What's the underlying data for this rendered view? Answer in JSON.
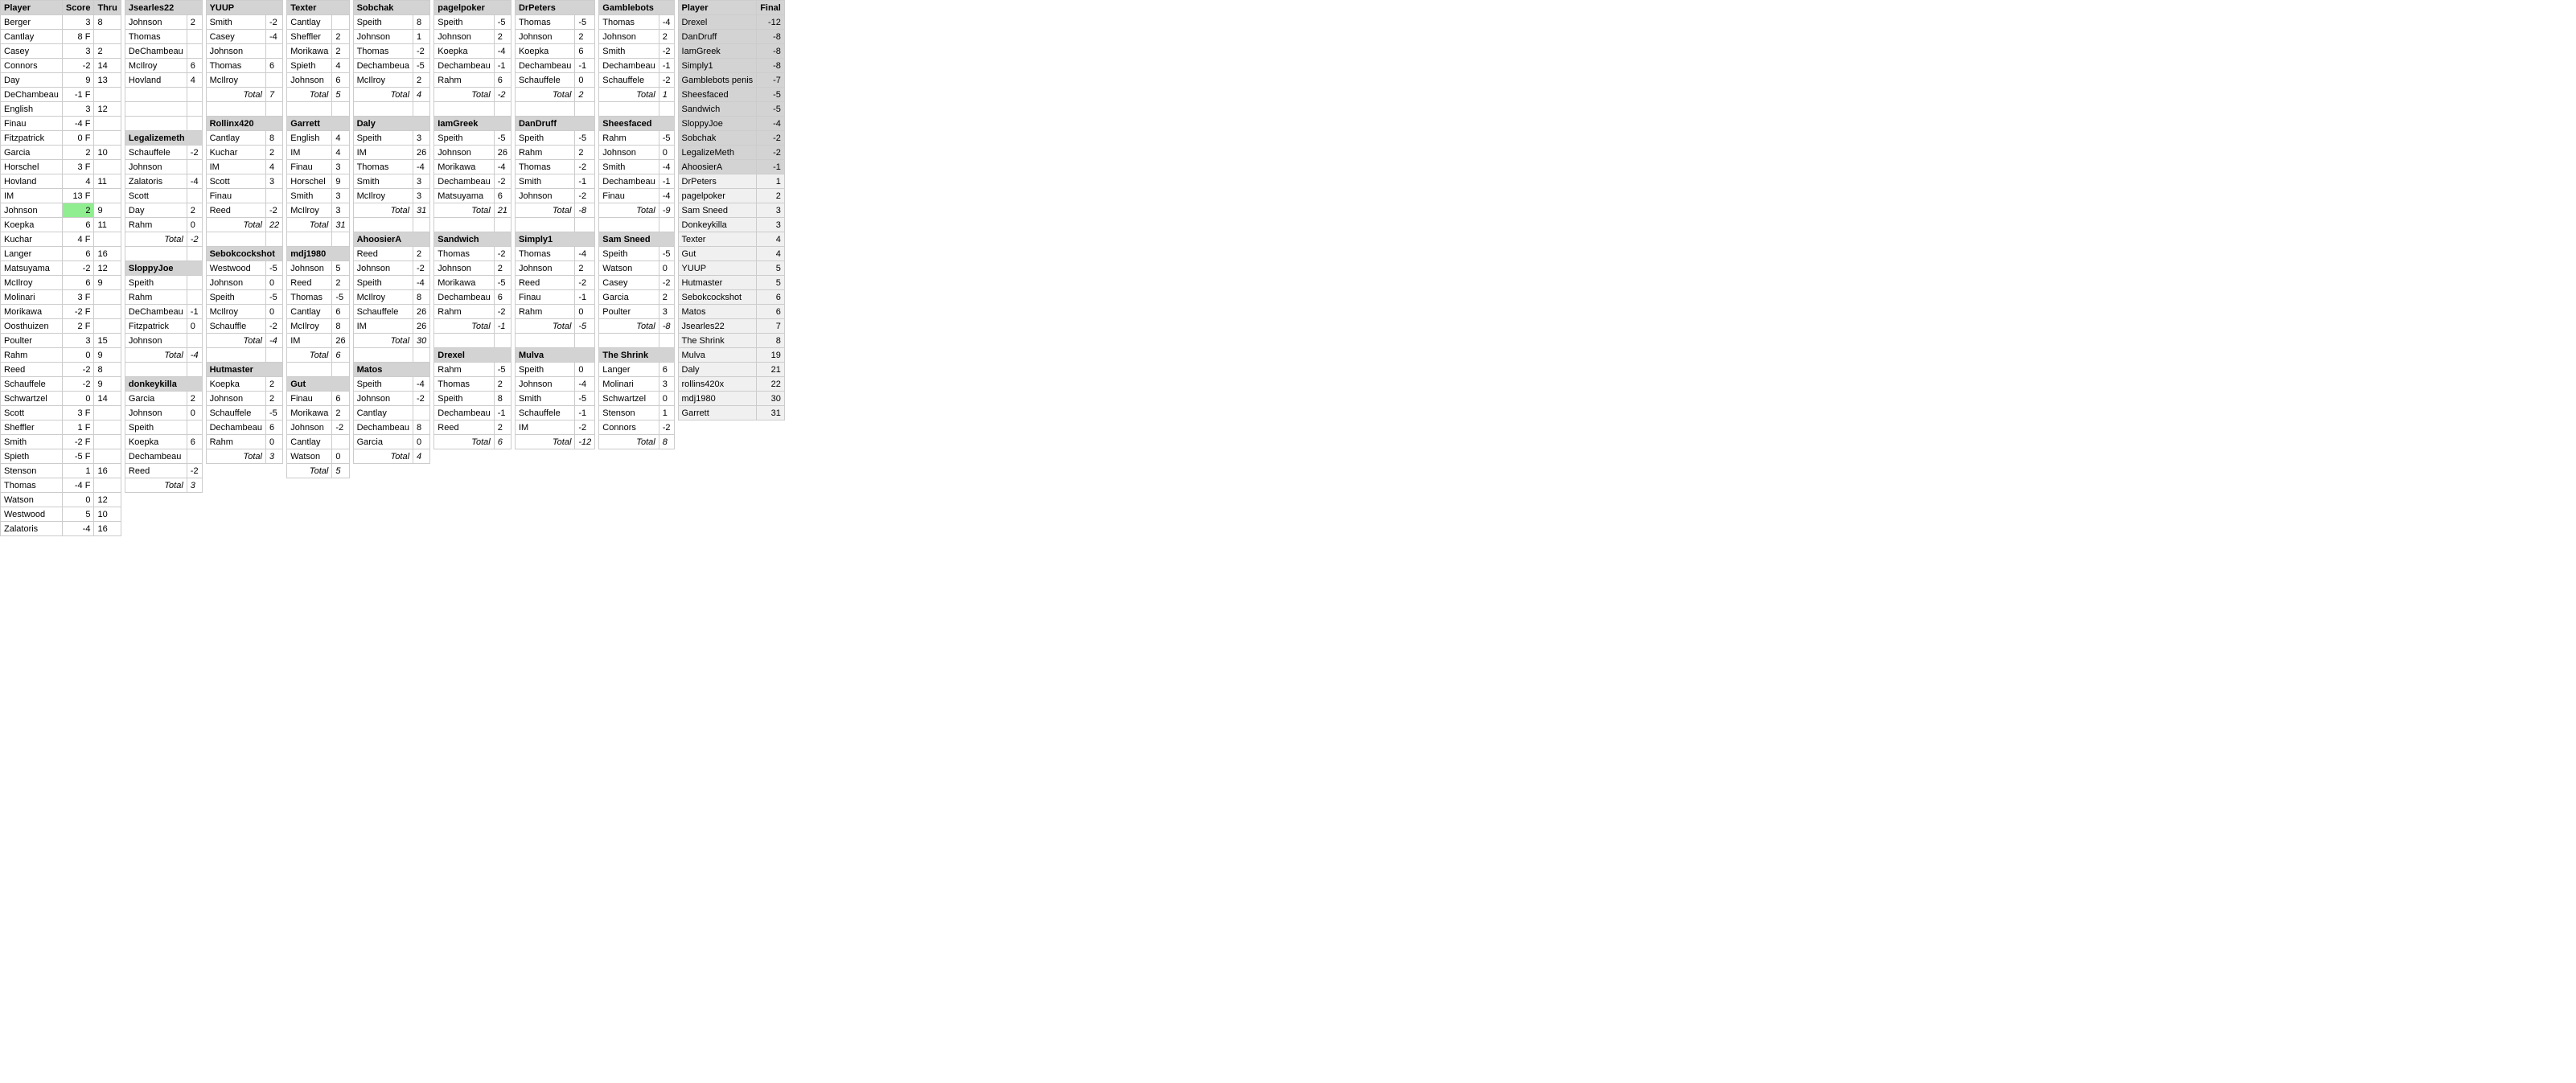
{
  "headers": {
    "player": "Player",
    "score": "Score",
    "thru": "Thru",
    "jsearles22": "Jsearles22",
    "yuup": "YUUP",
    "texter": "Texter",
    "sobchak": "Sobchak",
    "pagelpoker": "pagelpoker",
    "drpeters": "DrPeters",
    "gamblebots": "Gamblebots",
    "finalPlayer": "Player",
    "final": "Final"
  },
  "players": [
    {
      "name": "Berger",
      "score": "3",
      "thru": "8"
    },
    {
      "name": "Cantlay",
      "score": "8 F",
      "thru": ""
    },
    {
      "name": "Casey",
      "score": "3",
      "thru": "2"
    },
    {
      "name": "Connors",
      "score": "-2",
      "thru": "14"
    },
    {
      "name": "Day",
      "score": "9",
      "thru": "13"
    },
    {
      "name": "DeChambeau",
      "score": "-1 F",
      "thru": ""
    },
    {
      "name": "English",
      "score": "3",
      "thru": "12"
    },
    {
      "name": "Finau",
      "score": "-4 F",
      "thru": ""
    },
    {
      "name": "Fitzpatrick",
      "score": "0 F",
      "thru": ""
    },
    {
      "name": "Garcia",
      "score": "2",
      "thru": "10"
    },
    {
      "name": "Horschel",
      "score": "3 F",
      "thru": ""
    },
    {
      "name": "Hovland",
      "score": "4",
      "thru": "11"
    },
    {
      "name": "IM",
      "score": "13 F",
      "thru": ""
    },
    {
      "name": "Johnson",
      "score": "2",
      "thru": "9",
      "highlight": true
    },
    {
      "name": "Koepka",
      "score": "6",
      "thru": "11"
    },
    {
      "name": "Kuchar",
      "score": "4 F",
      "thru": ""
    },
    {
      "name": "Langer",
      "score": "6",
      "thru": "16"
    },
    {
      "name": "Matsuyama",
      "score": "-2",
      "thru": "12"
    },
    {
      "name": "McIlroy",
      "score": "6",
      "thru": "9"
    },
    {
      "name": "Molinari",
      "score": "3 F",
      "thru": ""
    },
    {
      "name": "Morikawa",
      "score": "-2 F",
      "thru": ""
    },
    {
      "name": "Oosthuizen",
      "score": "2 F",
      "thru": ""
    },
    {
      "name": "Poulter",
      "score": "3",
      "thru": "15"
    },
    {
      "name": "Rahm",
      "score": "0",
      "thru": "9"
    },
    {
      "name": "Reed",
      "score": "-2",
      "thru": "8"
    },
    {
      "name": "Schauffele",
      "score": "-2",
      "thru": "9"
    },
    {
      "name": "Schwartzel",
      "score": "0",
      "thru": "14"
    },
    {
      "name": "Scott",
      "score": "3 F",
      "thru": ""
    },
    {
      "name": "Sheffler",
      "score": "1 F",
      "thru": ""
    },
    {
      "name": "Smith",
      "score": "-2 F",
      "thru": ""
    },
    {
      "name": "Spieth",
      "score": "-5 F",
      "thru": ""
    },
    {
      "name": "Stenson",
      "score": "1",
      "thru": "16"
    },
    {
      "name": "Thomas",
      "score": "-4 F",
      "thru": ""
    },
    {
      "name": "Watson",
      "score": "0",
      "thru": "12"
    },
    {
      "name": "Westwood",
      "score": "5",
      "thru": "10"
    },
    {
      "name": "Zalatoris",
      "score": "-4",
      "thru": "16"
    }
  ],
  "jsearles22": {
    "header": "Jsearles22",
    "picks": [
      {
        "name": "Johnson",
        "val": "2"
      },
      {
        "name": "Thomas",
        "val": ""
      },
      {
        "name": "DeChambeau",
        "val": ""
      },
      {
        "name": "McIlroy",
        "val": "6"
      },
      {
        "name": "Hovland",
        "val": "4"
      },
      {
        "name": "",
        "val": ""
      },
      {
        "name": "",
        "val": ""
      },
      {
        "name": "",
        "val": ""
      },
      {
        "name": "Legalizemeth",
        "val": "",
        "section": true
      },
      {
        "name": "Schauffele",
        "val": "-2"
      },
      {
        "name": "Johnson",
        "val": ""
      },
      {
        "name": "Zalatoris",
        "val": "-4"
      },
      {
        "name": "Scott",
        "val": ""
      },
      {
        "name": "Day",
        "val": "2"
      },
      {
        "name": "Rahm",
        "val": "0"
      },
      {
        "name": "total",
        "val": "-2",
        "isTotal": true
      },
      {
        "name": "",
        "val": ""
      },
      {
        "name": "SloppyJoe",
        "val": "",
        "section": true
      },
      {
        "name": "Speith",
        "val": ""
      },
      {
        "name": "Rahm",
        "val": ""
      },
      {
        "name": "DeChambeau",
        "val": "-1"
      },
      {
        "name": "Fitzpatrick",
        "val": "0"
      },
      {
        "name": "Johnson",
        "val": ""
      },
      {
        "name": "total",
        "val": "-4",
        "isTotal": true
      },
      {
        "name": "",
        "val": ""
      },
      {
        "name": "donkeykilla",
        "val": "",
        "section": true
      },
      {
        "name": "Garcia",
        "val": "2"
      },
      {
        "name": "Johnson",
        "val": "0"
      },
      {
        "name": "Speith",
        "val": ""
      },
      {
        "name": "Koepka",
        "val": "6"
      },
      {
        "name": "Dechambeau",
        "val": ""
      },
      {
        "name": "Reed",
        "val": "-2"
      },
      {
        "name": "total",
        "val": "3",
        "isTotal": true
      }
    ]
  },
  "yuup": {
    "picks": [
      {
        "name": "Smith",
        "val": "-2"
      },
      {
        "name": "Casey",
        "val": "-4"
      },
      {
        "name": "Johnson",
        "val": ""
      },
      {
        "name": "Thomas",
        "val": "6"
      },
      {
        "name": "McIlroy",
        "val": ""
      },
      {
        "name": "total",
        "val": "7",
        "isTotal": true
      },
      {
        "name": "",
        "val": ""
      },
      {
        "name": "Rollinx420",
        "val": "",
        "section": true
      },
      {
        "name": "Cantlay",
        "val": "8"
      },
      {
        "name": "Kuchar",
        "val": "2"
      },
      {
        "name": "IM",
        "val": "4"
      },
      {
        "name": "Scott",
        "val": "3"
      },
      {
        "name": "Finau",
        "val": ""
      },
      {
        "name": "Reed",
        "val": "-2"
      },
      {
        "name": "total",
        "val": "22",
        "isTotal": true
      },
      {
        "name": "",
        "val": ""
      },
      {
        "name": "Sebokcockshot",
        "val": "",
        "section": true
      },
      {
        "name": "Westwood",
        "val": "-5"
      },
      {
        "name": "Johnson",
        "val": "0"
      },
      {
        "name": "Speith",
        "val": "-5"
      },
      {
        "name": "McIlroy",
        "val": "0"
      },
      {
        "name": "Schauffle",
        "val": "-2"
      },
      {
        "name": "total",
        "val": "-4",
        "isTotal": true
      },
      {
        "name": "",
        "val": ""
      },
      {
        "name": "Hutmaster",
        "val": "",
        "section": true
      },
      {
        "name": "Koepka",
        "val": "2"
      },
      {
        "name": "Johnson",
        "val": "2"
      },
      {
        "name": "Schauffele",
        "val": "-5"
      },
      {
        "name": "Dechambeau",
        "val": "6"
      },
      {
        "name": "Rahm",
        "val": "0"
      },
      {
        "name": "total",
        "val": "3",
        "isTotal": true
      }
    ]
  },
  "texter": {
    "picks": [
      {
        "name": "Cantlay",
        "val": ""
      },
      {
        "name": "Sheffler",
        "val": "2"
      },
      {
        "name": "Morikawa",
        "val": "2"
      },
      {
        "name": "Spieth",
        "val": "4"
      },
      {
        "name": "Johnson",
        "val": "6"
      },
      {
        "name": "total",
        "val": "5",
        "isTotal": true
      },
      {
        "name": "",
        "val": ""
      },
      {
        "name": "Garrett",
        "val": "",
        "section": true
      },
      {
        "name": "English",
        "val": "4"
      },
      {
        "name": "IM",
        "val": "4"
      },
      {
        "name": "Finau",
        "val": "3"
      },
      {
        "name": "Horschel",
        "val": "9"
      },
      {
        "name": "Smith",
        "val": "3"
      },
      {
        "name": "McIlroy",
        "val": "3"
      },
      {
        "name": "total",
        "val": "31",
        "isTotal": true
      },
      {
        "name": "",
        "val": ""
      },
      {
        "name": "mdj1980",
        "val": "",
        "section": true
      },
      {
        "name": "Johnson",
        "val": "5"
      },
      {
        "name": "Reed",
        "val": "2"
      },
      {
        "name": "Thomas",
        "val": "-5"
      },
      {
        "name": "Cantlay",
        "val": "6"
      },
      {
        "name": "McIlroy",
        "val": "8"
      },
      {
        "name": "IM",
        "val": "26"
      },
      {
        "name": "total",
        "val": "6",
        "isTotal": true
      },
      {
        "name": "",
        "val": ""
      },
      {
        "name": "Gut",
        "val": "",
        "section": true
      },
      {
        "name": "Finau",
        "val": "6"
      },
      {
        "name": "Morikawa",
        "val": "2"
      },
      {
        "name": "Johnson",
        "val": "-2"
      },
      {
        "name": "Cantlay",
        "val": ""
      },
      {
        "name": "Watson",
        "val": "0"
      },
      {
        "name": "total",
        "val": "5",
        "isTotal": true
      }
    ]
  },
  "sobchak": {
    "picks": [
      {
        "name": "Speith",
        "val": "8"
      },
      {
        "name": "Johnson",
        "val": "1"
      },
      {
        "name": "Thomas",
        "val": "-2"
      },
      {
        "name": "Dechambeua",
        "val": "-5"
      },
      {
        "name": "McIlroy",
        "val": "2"
      },
      {
        "name": "total",
        "val": "4",
        "isTotal": true
      },
      {
        "name": "",
        "val": ""
      },
      {
        "name": "Daly",
        "val": "",
        "section": true
      },
      {
        "name": "Speith",
        "val": "3"
      },
      {
        "name": "IM",
        "val": "26"
      },
      {
        "name": "Thomas",
        "val": "-4"
      },
      {
        "name": "Smith",
        "val": "3"
      },
      {
        "name": "McIlroy",
        "val": "3"
      },
      {
        "name": "total",
        "val": "31",
        "isTotal": true
      },
      {
        "name": "",
        "val": ""
      },
      {
        "name": "AhoosierA",
        "val": "",
        "section": true
      },
      {
        "name": "Reed",
        "val": "2"
      },
      {
        "name": "Johnson",
        "val": "-2"
      },
      {
        "name": "Speith",
        "val": "-4"
      },
      {
        "name": "McIlroy",
        "val": "8"
      },
      {
        "name": "Schauffele",
        "val": "26"
      },
      {
        "name": "IM",
        "val": "26"
      },
      {
        "name": "total",
        "val": "30",
        "isTotal": true
      },
      {
        "name": "",
        "val": ""
      },
      {
        "name": "Matos",
        "val": "",
        "section": true
      },
      {
        "name": "Speith",
        "val": "-4"
      },
      {
        "name": "Johnson",
        "val": "-2"
      },
      {
        "name": "Cantlay",
        "val": ""
      },
      {
        "name": "Dechambeau",
        "val": "8"
      },
      {
        "name": "Garcia",
        "val": "0"
      },
      {
        "name": "total",
        "val": "4",
        "isTotal": true
      }
    ]
  },
  "pagelpoker": {
    "picks": [
      {
        "name": "Speith",
        "val": "-5"
      },
      {
        "name": "Johnson",
        "val": "2"
      },
      {
        "name": "Koepka",
        "val": "-4"
      },
      {
        "name": "Dechambeau",
        "val": "-1"
      },
      {
        "name": "Rahm",
        "val": "6"
      },
      {
        "name": "total",
        "val": "-2",
        "isTotal": true
      },
      {
        "name": "",
        "val": ""
      },
      {
        "name": "IamGreek",
        "val": "",
        "section": true
      },
      {
        "name": "Speith",
        "val": "-5"
      },
      {
        "name": "Johnson",
        "val": "26"
      },
      {
        "name": "Morikawa",
        "val": "-4"
      },
      {
        "name": "Dechambeau",
        "val": "-2"
      },
      {
        "name": "Matsuyama",
        "val": "6"
      },
      {
        "name": "total",
        "val": "21",
        "isTotal": true
      },
      {
        "name": "",
        "val": ""
      },
      {
        "name": "Sandwich",
        "val": "",
        "section": true
      },
      {
        "name": "Thomas",
        "val": "-2"
      },
      {
        "name": "Johnson",
        "val": "2"
      },
      {
        "name": "Morikawa",
        "val": "-5"
      },
      {
        "name": "Dechambeau",
        "val": "6"
      },
      {
        "name": "Rahm",
        "val": "-2"
      },
      {
        "name": "total",
        "val": "-1",
        "isTotal": true
      },
      {
        "name": "",
        "val": ""
      },
      {
        "name": "Drexel",
        "val": "",
        "section": true
      },
      {
        "name": "Rahm",
        "val": "-5"
      },
      {
        "name": "Thomas",
        "val": "2"
      },
      {
        "name": "Speith",
        "val": "8"
      },
      {
        "name": "Dechambeau",
        "val": "-1"
      },
      {
        "name": "Reed",
        "val": "2"
      },
      {
        "name": "total",
        "val": "6",
        "isTotal": true
      }
    ]
  },
  "drpeters": {
    "picks": [
      {
        "name": "Thomas",
        "val": "-5"
      },
      {
        "name": "Johnson",
        "val": "2"
      },
      {
        "name": "Koepka",
        "val": "6"
      },
      {
        "name": "Dechambeau",
        "val": "-1"
      },
      {
        "name": "Schauffele",
        "val": "0"
      },
      {
        "name": "total",
        "val": "2",
        "isTotal": true
      },
      {
        "name": "",
        "val": ""
      },
      {
        "name": "DanDruff",
        "val": "",
        "section": true
      },
      {
        "name": "Speith",
        "val": "-5"
      },
      {
        "name": "Rahm",
        "val": "2"
      },
      {
        "name": "Thomas",
        "val": "-2"
      },
      {
        "name": "Smith",
        "val": "-1"
      },
      {
        "name": "Johnson",
        "val": "-2"
      },
      {
        "name": "total",
        "val": "-8",
        "isTotal": true
      },
      {
        "name": "",
        "val": ""
      },
      {
        "name": "Simply1",
        "val": "",
        "section": true
      },
      {
        "name": "Thomas",
        "val": "-4"
      },
      {
        "name": "Johnson",
        "val": "2"
      },
      {
        "name": "Reed",
        "val": "-2"
      },
      {
        "name": "Finau",
        "val": "-1"
      },
      {
        "name": "Rahm",
        "val": "0"
      },
      {
        "name": "total",
        "val": "-5",
        "isTotal": true
      },
      {
        "name": "",
        "val": ""
      },
      {
        "name": "Mulva",
        "val": "",
        "section": true
      },
      {
        "name": "Speith",
        "val": "0"
      },
      {
        "name": "Johnson",
        "val": "-4"
      },
      {
        "name": "Smith",
        "val": "-5"
      },
      {
        "name": "Schauffele",
        "val": "-1"
      },
      {
        "name": "IM",
        "val": "-2"
      },
      {
        "name": "total",
        "val": "-12",
        "isTotal": true
      }
    ]
  },
  "gamblebots": {
    "picks": [
      {
        "name": "Thomas",
        "val": "-4"
      },
      {
        "name": "Johnson",
        "val": "2"
      },
      {
        "name": "Smith",
        "val": "-2"
      },
      {
        "name": "Dechambeau",
        "val": "-1"
      },
      {
        "name": "Schauffele",
        "val": "-2"
      },
      {
        "name": "total",
        "val": "1",
        "isTotal": true
      },
      {
        "name": "",
        "val": ""
      },
      {
        "name": "Sheesfaced",
        "val": "",
        "section": true
      },
      {
        "name": "Rahm",
        "val": "-5"
      },
      {
        "name": "Johnson",
        "val": "0"
      },
      {
        "name": "Smith",
        "val": "-4"
      },
      {
        "name": "Dechambeau",
        "val": "-1"
      },
      {
        "name": "Finau",
        "val": "-4"
      },
      {
        "name": "total",
        "val": "-9",
        "isTotal": true
      },
      {
        "name": "",
        "val": ""
      },
      {
        "name": "Sam Sneed",
        "val": "",
        "section": true
      },
      {
        "name": "Speith",
        "val": "-5"
      },
      {
        "name": "Watson",
        "val": "0"
      },
      {
        "name": "Casey",
        "val": "-2"
      },
      {
        "name": "Garcia",
        "val": "2"
      },
      {
        "name": "Poulter",
        "val": "3"
      },
      {
        "name": "total",
        "val": "-8",
        "isTotal": true
      },
      {
        "name": "",
        "val": ""
      },
      {
        "name": "The Shrink",
        "val": "",
        "section": true
      },
      {
        "name": "Langer",
        "val": "6"
      },
      {
        "name": "Molinari",
        "val": "3"
      },
      {
        "name": "Schwartzel",
        "val": "0"
      },
      {
        "name": "Stenson",
        "val": "1"
      },
      {
        "name": "Connors",
        "val": "-2"
      },
      {
        "name": "total",
        "val": "8",
        "isTotal": true
      }
    ]
  },
  "finalStandings": [
    {
      "name": "Drexel",
      "val": "-12"
    },
    {
      "name": "DanDruff",
      "val": "-8"
    },
    {
      "name": "IamGreek",
      "val": "-8"
    },
    {
      "name": "Simply1",
      "val": "-8"
    },
    {
      "name": "Gamblebots penis",
      "val": "-7"
    },
    {
      "name": "Sheesfaced",
      "val": "-5"
    },
    {
      "name": "Sandwich",
      "val": "-5"
    },
    {
      "name": "SloppyJoe",
      "val": "-4"
    },
    {
      "name": "Sobchak",
      "val": "-2"
    },
    {
      "name": "LegalizeMeth",
      "val": "-2"
    },
    {
      "name": "AhoosierA",
      "val": "-1"
    },
    {
      "name": "DrPeters",
      "val": "1"
    },
    {
      "name": "pagelpoker",
      "val": "2"
    },
    {
      "name": "Sam Sneed",
      "val": "3"
    },
    {
      "name": "Donkeykilla",
      "val": "3"
    },
    {
      "name": "Texter",
      "val": "4"
    },
    {
      "name": "Gut",
      "val": "4"
    },
    {
      "name": "YUUP",
      "val": "5"
    },
    {
      "name": "Hutmaster",
      "val": "5"
    },
    {
      "name": "Sebokcockshot",
      "val": "6"
    },
    {
      "name": "Matos",
      "val": "6"
    },
    {
      "name": "Jsearles22",
      "val": "7"
    },
    {
      "name": "The Shrink",
      "val": "8"
    },
    {
      "name": "Mulva",
      "val": "19"
    },
    {
      "name": "Daly",
      "val": "21"
    },
    {
      "name": "rollins420x",
      "val": "22"
    },
    {
      "name": "mdj1980",
      "val": "30"
    },
    {
      "name": "Garrett",
      "val": "31"
    }
  ]
}
